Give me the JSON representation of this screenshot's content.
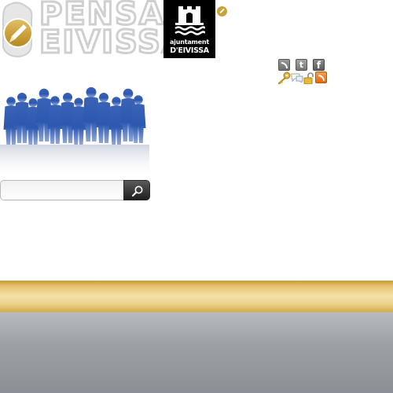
{
  "header": {
    "logo_line1": "PENSA",
    "logo_line2": "EIVISSA",
    "ajuntament_line1": "ajuntament",
    "ajuntament_line2": "D'EIVISSA"
  },
  "social_icons": {
    "rss": "rss-icon",
    "twitter": "twitter-icon",
    "twitter_glyph": "t",
    "facebook": "facebook-icon",
    "facebook_glyph": "f"
  },
  "util_icons": [
    "key-icon",
    "chat-icon",
    "lock-icon",
    "rss-icon"
  ],
  "search": {
    "value": "",
    "placeholder": ""
  },
  "colors": {
    "gold": "#c89a2c",
    "grey": "#9da1a6",
    "people_blue": "#2b55a8"
  }
}
